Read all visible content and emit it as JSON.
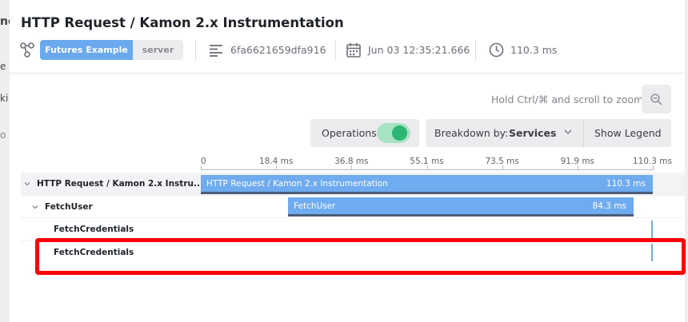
{
  "background": {
    "left_fragments": [
      "nc",
      "e",
      "ki",
      "o"
    ]
  },
  "header": {
    "title": "HTTP Request / Kamon 2.x Instrumentation",
    "service_tag": "Futures Example",
    "kind_tag": "server",
    "trace_id": "6fa6621659dfa916",
    "timestamp": "Jun 03 12:35:21.666",
    "duration": "110.3 ms",
    "icons": [
      "trace-graph-icon",
      "document-lines-icon",
      "calendar-icon",
      "clock-icon"
    ]
  },
  "toolbar": {
    "zoom_hint": "Hold Ctrl/⌘ and scroll to zoom",
    "operations_label": "Operations",
    "operations_enabled": true,
    "breakdown_label": "Breakdown by:",
    "breakdown_value": "Services",
    "show_legend": "Show Legend"
  },
  "timeline": {
    "ticks": [
      "0",
      "18.4 ms",
      "36.8 ms",
      "55.1 ms",
      "73.5 ms",
      "91.9 ms",
      "110.3 ms"
    ],
    "total_ms": 110.3,
    "rows": [
      {
        "label": "HTTP Request / Kamon 2.x Instru...",
        "bar_label": "HTTP Request / Kamon 2.x Instrumentation",
        "duration": "110.3 ms",
        "start_ms": 0,
        "duration_ms": 110.3,
        "expanded": true
      },
      {
        "label": "FetchUser",
        "bar_label": "FetchUser",
        "duration": "84.3 ms",
        "start_ms": 21.3,
        "duration_ms": 84.3,
        "expanded": true
      },
      {
        "label": "FetchCredentials",
        "start_ms": 109.9,
        "duration_ms": 0.4
      },
      {
        "label": "FetchCredentials",
        "start_ms": 109.9,
        "duration_ms": 0.4
      }
    ]
  },
  "colors": {
    "accent": "#6aa9ee",
    "bar": "#6fabef",
    "bar_shadow": "#4a5c78",
    "toggle": "#2bb673",
    "highlight": "#ff0000"
  }
}
